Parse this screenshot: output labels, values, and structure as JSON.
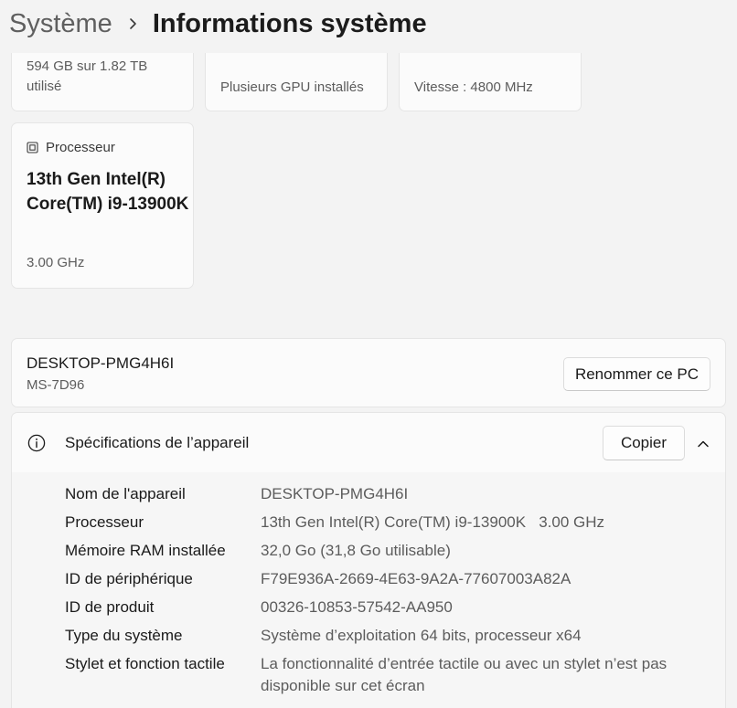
{
  "breadcrumb": {
    "parent": "Système",
    "current": "Informations système"
  },
  "tiles_top": {
    "storage": {
      "value": "594 GB sur 1.82 TB utilisé"
    },
    "gpu": {
      "value": "Plusieurs GPU installés"
    },
    "ram": {
      "value": "Vitesse : 4800 MHz"
    }
  },
  "processor_tile": {
    "label": "Processeur",
    "name": "13th Gen Intel(R) Core(TM) i9-13900K",
    "speed": "3.00 GHz"
  },
  "pc_card": {
    "name": "DESKTOP-PMG4H6I",
    "model": "MS-7D96",
    "rename_button": "Renommer ce PC"
  },
  "specs": {
    "title": "Spécifications de l’appareil",
    "copy_button": "Copier",
    "rows": [
      {
        "label": "Nom de l'appareil",
        "value": "DESKTOP-PMG4H6I"
      },
      {
        "label": "Processeur",
        "value": "13th Gen Intel(R) Core(TM) i9-13900K   3.00 GHz"
      },
      {
        "label": "Mémoire RAM installée",
        "value": "32,0 Go (31,8 Go utilisable)"
      },
      {
        "label": "ID de périphérique",
        "value": "F79E936A-2669-4E63-9A2A-77607003A82A"
      },
      {
        "label": "ID de produit",
        "value": "00326-10853-57542-AA950"
      },
      {
        "label": "Type du système",
        "value": "Système d’exploitation 64 bits, processeur x64"
      },
      {
        "label": "Stylet et fonction tactile",
        "value": "La fonctionnalité d’entrée tactile ou avec un stylet n’est pas disponible sur cet écran"
      }
    ]
  },
  "icons": {
    "breadcrumb_separator": "chevron-right-icon",
    "processor": "processor-chip-icon",
    "specs": "info-icon",
    "collapse": "chevron-up-icon"
  }
}
